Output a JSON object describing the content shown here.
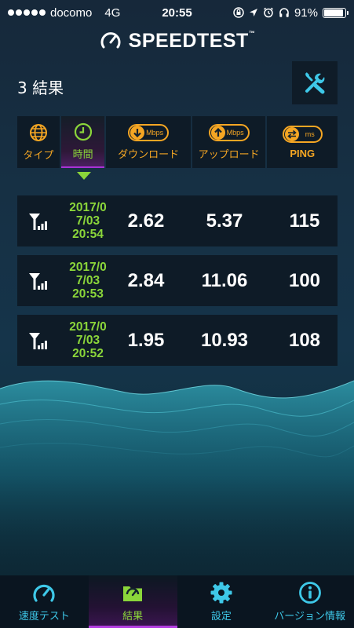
{
  "status_bar": {
    "carrier": "docomo",
    "network": "4G",
    "time": "20:55",
    "battery": "91%"
  },
  "header": {
    "logo_text": "SPEEDTEST",
    "trademark": "™"
  },
  "results": {
    "count_label": "3 結果"
  },
  "columns": {
    "type": "タイプ",
    "time": "時間",
    "download": "ダウンロード",
    "download_unit": "Mbps",
    "upload": "アップロード",
    "upload_unit": "Mbps",
    "ping": "PING",
    "ping_unit": "ms"
  },
  "rows": [
    {
      "date_l1": "2017/0",
      "date_l2": "7/03",
      "date_l3": "20:54",
      "download": "2.62",
      "upload": "5.37",
      "ping": "115"
    },
    {
      "date_l1": "2017/0",
      "date_l2": "7/03",
      "date_l3": "20:53",
      "download": "2.84",
      "upload": "11.06",
      "ping": "100"
    },
    {
      "date_l1": "2017/0",
      "date_l2": "7/03",
      "date_l3": "20:52",
      "download": "1.95",
      "upload": "10.93",
      "ping": "108"
    }
  ],
  "tabs": [
    {
      "label": "速度テスト"
    },
    {
      "label": "結果"
    },
    {
      "label": "設定"
    },
    {
      "label": "バージョン情報"
    }
  ],
  "colors": {
    "accent_green": "#8bd63a",
    "accent_orange": "#f5a623",
    "accent_cyan": "#3ec8e8",
    "accent_purple": "#b33de0"
  },
  "icons": {
    "tools": "wrench-screwdriver-icon",
    "type": "globe-icon",
    "time": "clock-icon",
    "download": "arrow-down-icon",
    "upload": "arrow-up-icon",
    "ping": "ping-arrows-icon",
    "connection": "cellular-antenna-icon"
  }
}
